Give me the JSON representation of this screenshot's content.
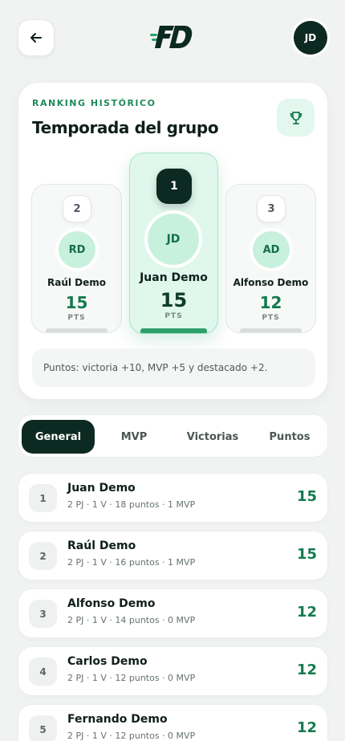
{
  "header": {
    "logo_text": "FD",
    "user_initials": "JD"
  },
  "ranking_card": {
    "eyebrow": "RANKING HISTÓRICO",
    "title": "Temporada del grupo",
    "podium": [
      {
        "place": "2",
        "initials": "RD",
        "name": "Raúl Demo",
        "points": "15",
        "unit": "PTS"
      },
      {
        "place": "1",
        "initials": "JD",
        "name": "Juan Demo",
        "points": "15",
        "unit": "PTS"
      },
      {
        "place": "3",
        "initials": "AD",
        "name": "Alfonso Demo",
        "points": "12",
        "unit": "PTS"
      }
    ],
    "points_note": "Puntos: victoria +10, MVP +5 y destacado +2."
  },
  "tabs": [
    {
      "label": "General",
      "active": true
    },
    {
      "label": "MVP",
      "active": false
    },
    {
      "label": "Victorias",
      "active": false
    },
    {
      "label": "Puntos",
      "active": false
    }
  ],
  "ranking_list": [
    {
      "rank": "1",
      "name": "Juan Demo",
      "stats": "2 PJ · 1 V · 18 puntos · 1 MVP",
      "points": "15"
    },
    {
      "rank": "2",
      "name": "Raúl Demo",
      "stats": "2 PJ · 1 V · 16 puntos · 1 MVP",
      "points": "15"
    },
    {
      "rank": "3",
      "name": "Alfonso Demo",
      "stats": "2 PJ · 1 V · 14 puntos · 0 MVP",
      "points": "12"
    },
    {
      "rank": "4",
      "name": "Carlos Demo",
      "stats": "2 PJ · 1 V · 12 puntos · 0 MVP",
      "points": "12"
    },
    {
      "rank": "5",
      "name": "Fernando Demo",
      "stats": "2 PJ · 1 V · 12 puntos · 0 MVP",
      "points": "12"
    }
  ],
  "colors": {
    "brand_dark": "#0d2a22",
    "accent_green": "#157a4f",
    "mint": "#dff7ec"
  },
  "icons": {
    "back": "arrow-left-icon",
    "trophy": "trophy-icon"
  }
}
